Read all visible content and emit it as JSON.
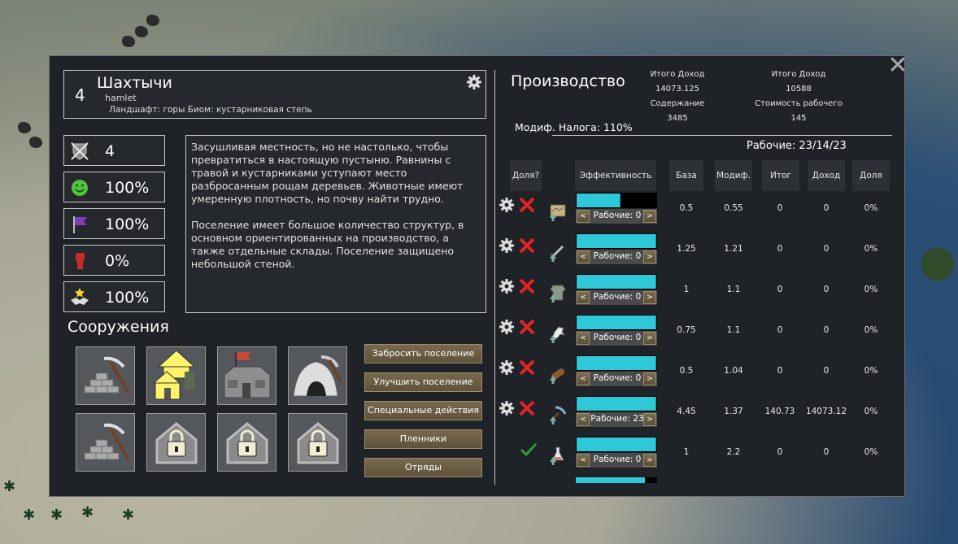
{
  "settlement": {
    "tier": "4",
    "name": "Шахтычи",
    "type": "hamlet",
    "terrain": "Ландшафт: горы Биом: кустарниковая степь"
  },
  "stats": [
    {
      "icon": "crossed-swords-shield-icon",
      "value": "4"
    },
    {
      "icon": "smiley-face-icon",
      "value": "100%"
    },
    {
      "icon": "purple-flag-icon",
      "value": "100%"
    },
    {
      "icon": "red-fist-icon",
      "value": "0%"
    },
    {
      "icon": "handshake-star-icon",
      "value": "100%"
    }
  ],
  "description": "Засушливая местность, но не настолько, чтобы превратиться в настоящую пустыню. Равнины с травой и кустарниками уступают место разбросанным рощам деревьев. Животные имеют умеренную плотность, но почву найти трудно.\n\nПоселение имеет большое количество структур, в основном ориентированных на производство, а также отдельные склады. Поселение защищено небольшой стеной.",
  "structures_title": "Сооружения",
  "buildings": [
    {
      "name": "mine-bricks-building"
    },
    {
      "name": "upgrade-houses-building"
    },
    {
      "name": "flag-hall-building"
    },
    {
      "name": "cave-mine-building"
    },
    {
      "name": "mine-bricks-building-2"
    },
    {
      "name": "locked-slot"
    },
    {
      "name": "locked-slot"
    },
    {
      "name": "locked-slot"
    }
  ],
  "actions": {
    "abandon": "Забросить поселение",
    "upgrade": "Улучшить поселение",
    "special": "Специальные действия",
    "prisoners": "Пленники",
    "squads": "Отряды"
  },
  "production": {
    "title": "Производство",
    "total_income_label_1": "Итого  Доход",
    "total_income_value_1": "14073.125",
    "upkeep_label": "Содержание",
    "upkeep_value": "3485",
    "total_income_label_2": "Итого  Доход",
    "total_income_value_2": "10588",
    "worker_cost_label": "Стоимость рабочего",
    "worker_cost_value": "145",
    "tax_modifier": "Модиф. Налога: 110%",
    "workers": "Рабочие: 23/14/23",
    "columns": {
      "share_q": "Доля?",
      "efficiency": "Эффективность",
      "base": "База",
      "modifier": "Модиф.",
      "total": "Итог",
      "income": "Доход",
      "share": "Доля"
    },
    "rows": [
      {
        "icon": "map-icon",
        "fill": 0.55,
        "workers": "Рабочие: 0",
        "base": "0.5",
        "mod": "0.55",
        "total": "0",
        "income": "0",
        "share": "0%",
        "enabled": false
      },
      {
        "icon": "sword-icon",
        "fill": 1.0,
        "workers": "Рабочие: 0",
        "base": "1.25",
        "mod": "1.21",
        "total": "0",
        "income": "0",
        "share": "0%",
        "enabled": false
      },
      {
        "icon": "armor-icon",
        "fill": 1.0,
        "workers": "Рабочие: 0",
        "base": "1",
        "mod": "1.1",
        "total": "0",
        "income": "0",
        "share": "0%",
        "enabled": false
      },
      {
        "icon": "horse-icon",
        "fill": 1.0,
        "workers": "Рабочие: 0",
        "base": "0.75",
        "mod": "1.1",
        "total": "0",
        "income": "0",
        "share": "0%",
        "enabled": false
      },
      {
        "icon": "wood-log-icon",
        "fill": 1.0,
        "workers": "Рабочие: 0",
        "base": "0.5",
        "mod": "1.04",
        "total": "0",
        "income": "0",
        "share": "0%",
        "enabled": false
      },
      {
        "icon": "ore-pickaxe-icon",
        "fill": 1.0,
        "workers": "Рабочие: 23",
        "base": "4.45",
        "mod": "1.37",
        "total": "140.73",
        "income": "14073.12",
        "share": "0%",
        "enabled": false
      },
      {
        "icon": "alchemy-flask-icon",
        "fill": 1.0,
        "workers": "Рабочие: 0",
        "base": "1",
        "mod": "2.2",
        "total": "0",
        "income": "0",
        "share": "0%",
        "enabled": true
      }
    ]
  },
  "colors": {
    "panel_bg": "#1f2226",
    "bar_fill": "#2ec8d8",
    "button": "#6b5e44",
    "red_x": "#e02424",
    "green_check": "#2f9a36"
  }
}
